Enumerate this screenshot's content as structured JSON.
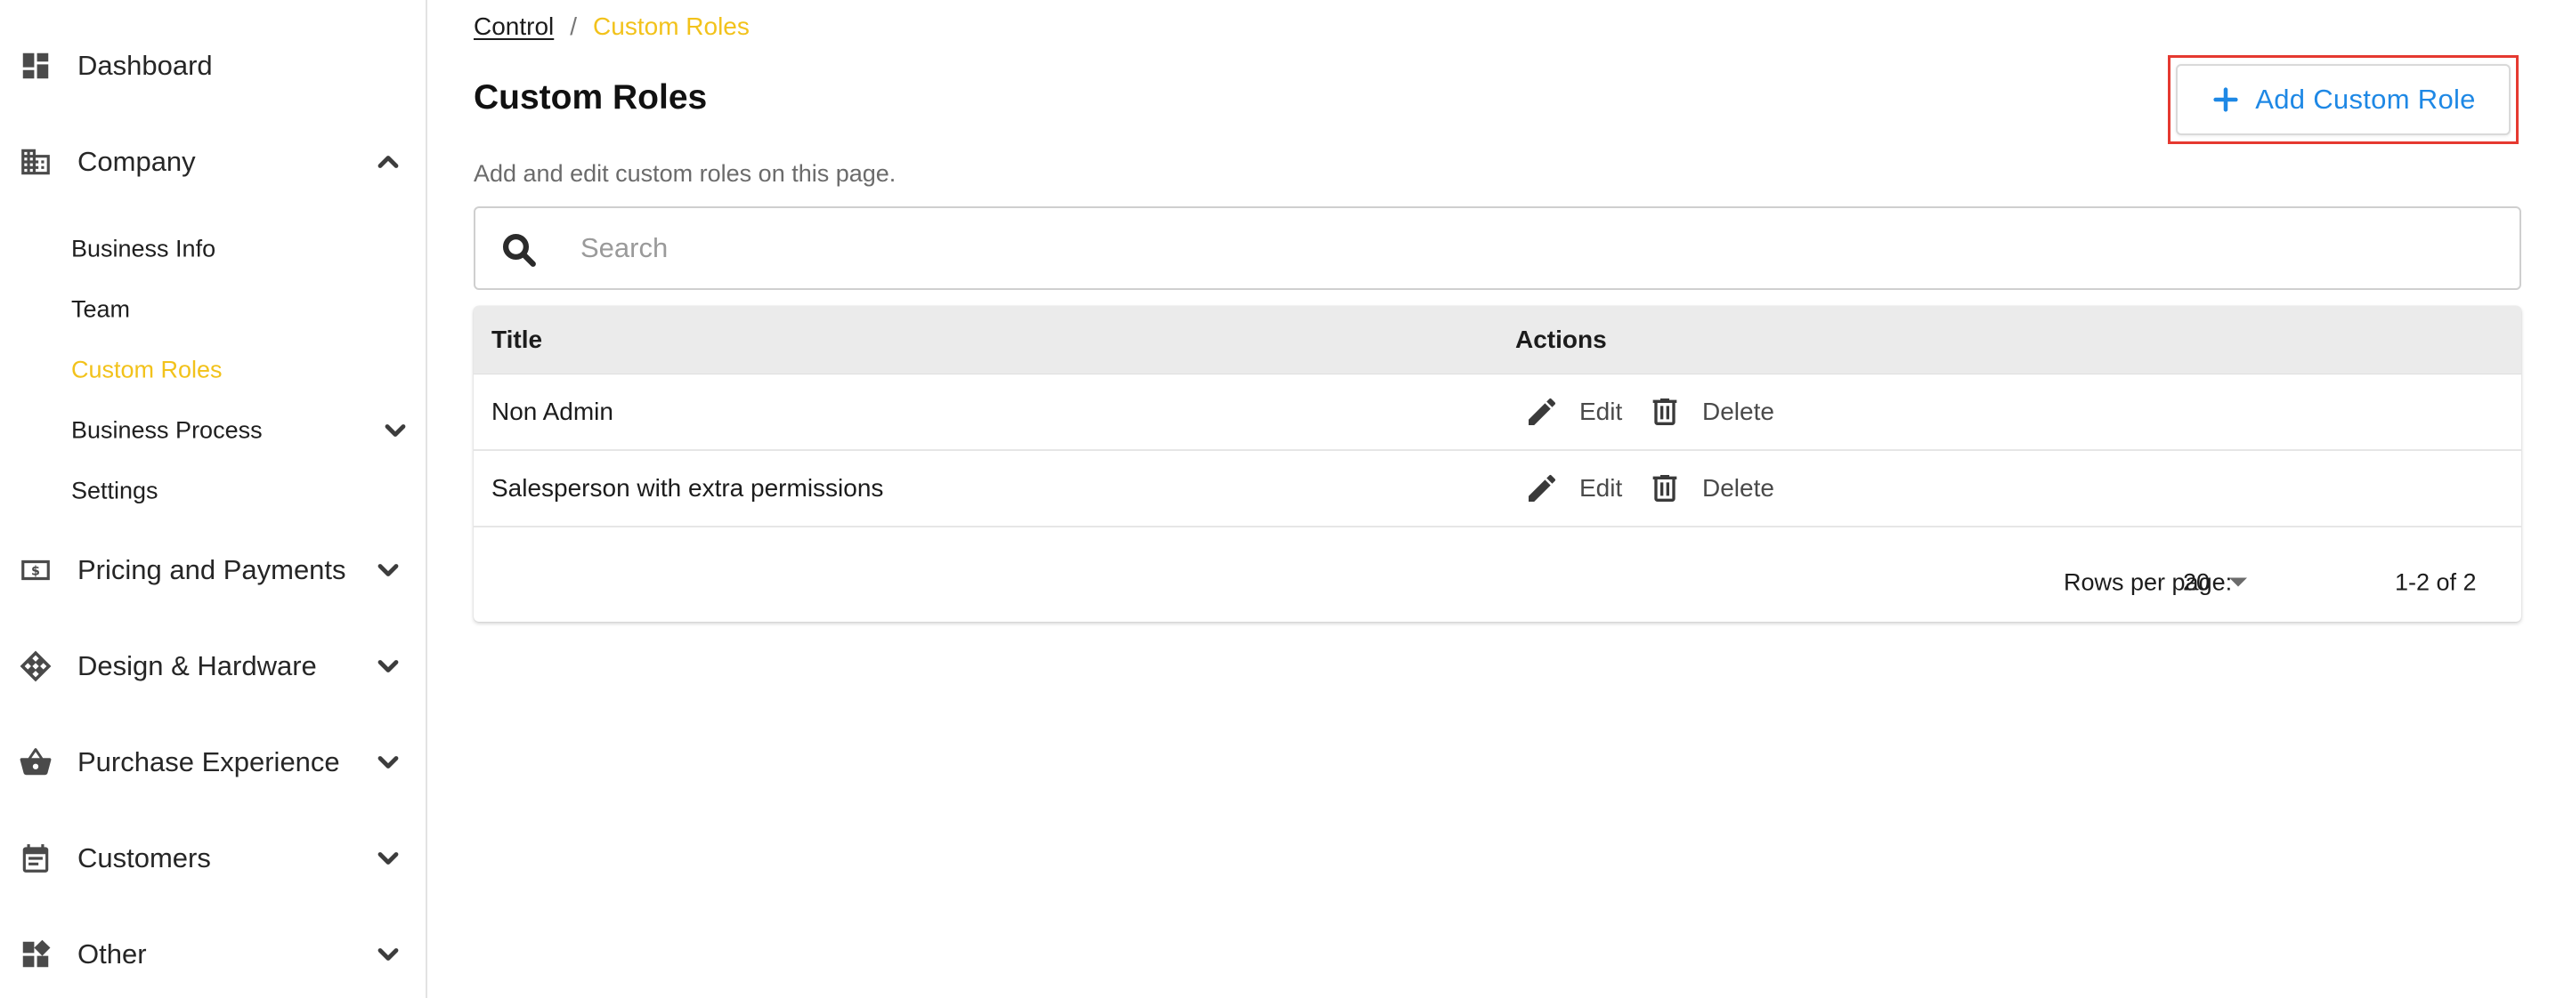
{
  "sidebar": {
    "dashboard": "Dashboard",
    "company": "Company",
    "company_items": {
      "business_info": "Business Info",
      "team": "Team",
      "custom_roles": "Custom Roles",
      "business_process": "Business Process",
      "settings": "Settings"
    },
    "pricing": "Pricing and Payments",
    "design": "Design & Hardware",
    "purchase": "Purchase Experience",
    "customers": "Customers",
    "other": "Other"
  },
  "breadcrumb": {
    "parent": "Control",
    "separator": "/",
    "current": "Custom Roles"
  },
  "page": {
    "title": "Custom Roles",
    "subtitle": "Add and edit custom roles on this page.",
    "add_button": "Add Custom Role"
  },
  "search": {
    "placeholder": "Search",
    "value": ""
  },
  "table": {
    "columns": {
      "title": "Title",
      "actions": "Actions"
    },
    "rows": [
      {
        "title": "Non Admin",
        "edit": "Edit",
        "delete": "Delete"
      },
      {
        "title": "Salesperson with extra permissions",
        "edit": "Edit",
        "delete": "Delete"
      }
    ],
    "pagination": {
      "rows_per_page_label": "Rows per page:",
      "rows_per_page": "20",
      "range": "1-2 of 2"
    }
  },
  "colors": {
    "accent_yellow": "#f2c21b",
    "button_blue": "#1e88e5",
    "highlight_red": "#e53930"
  }
}
